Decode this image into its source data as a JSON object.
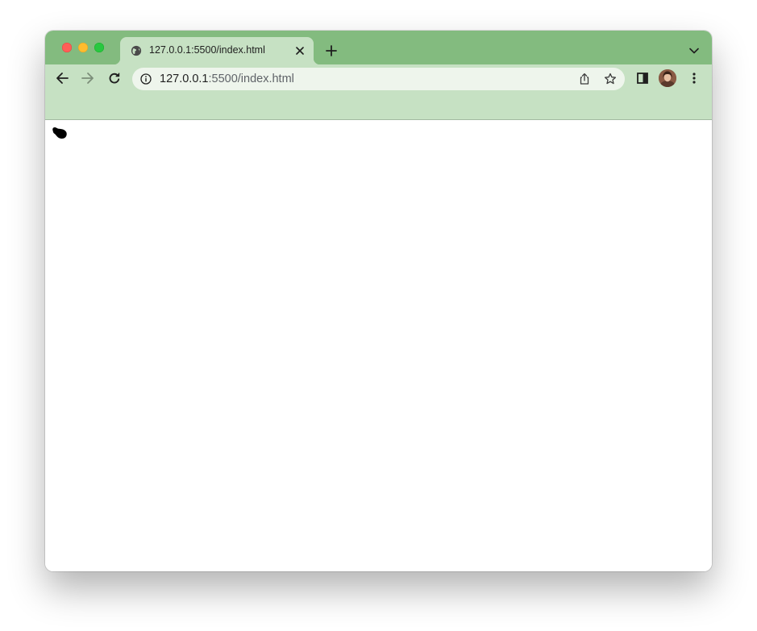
{
  "browser": {
    "tab": {
      "title": "127.0.0.1:5500/index.html",
      "favicon": "globe-icon"
    },
    "address_bar": {
      "host": "127.0.0.1",
      "path": ":5500/index.html",
      "info_icon": "info-icon"
    },
    "colors": {
      "tabstrip": "#83bb7f",
      "toolbar": "#c6e1c3",
      "omnibox": "#eef5ec"
    },
    "toolbar_icons": [
      "back-arrow-icon",
      "forward-arrow-icon",
      "reload-icon",
      "share-icon",
      "star-icon",
      "side-panel-icon",
      "profile-avatar",
      "more-menu-icon"
    ]
  },
  "page": {
    "content_shape": "black-blob"
  }
}
